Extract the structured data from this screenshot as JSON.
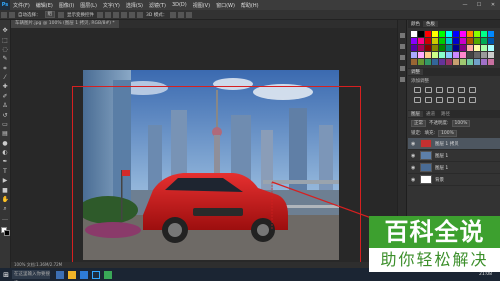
{
  "app": {
    "logo": "Ps"
  },
  "menu": [
    "文件(F)",
    "编辑(E)",
    "图像(I)",
    "图层(L)",
    "文字(Y)",
    "选择(S)",
    "滤镜(T)",
    "3D(D)",
    "视图(V)",
    "窗口(W)",
    "帮助(H)"
  ],
  "window_controls": [
    "—",
    "☐",
    "✕"
  ],
  "options": {
    "auto_select_label": "自动选择：",
    "auto_select_value": "组",
    "transform_label": "显示变换控件",
    "mode_label": "3D 模式："
  },
  "document_tab": "车辆图片.jpg @ 100% (图层 1 拷贝, RGB/8#) *",
  "status": {
    "zoom": "100%",
    "doc": "文档:1.36M/2.72M"
  },
  "panels": {
    "tabs": [
      "颜色",
      "色板"
    ],
    "adjust_title": "调整",
    "adjust_subtitle": "添加调整",
    "layers_tabs": [
      "图层",
      "通道",
      "路径"
    ],
    "blend_mode": "正常",
    "opacity_label": "不透明度:",
    "opacity_value": "100%",
    "lock_label": "锁定:",
    "fill_label": "填充:",
    "fill_value": "100%",
    "layers": [
      {
        "name": "图层 1 拷贝",
        "selected": true
      },
      {
        "name": "图层 1",
        "selected": false
      },
      {
        "name": "图层 1",
        "selected": false
      },
      {
        "name": "背景",
        "selected": false
      }
    ]
  },
  "swatch_colors": [
    "#ffffff",
    "#000000",
    "#ff0000",
    "#ffff00",
    "#00ff00",
    "#00ffff",
    "#0000ff",
    "#ff00ff",
    "#ff8800",
    "#88ff00",
    "#00ff88",
    "#0088ff",
    "#8800ff",
    "#ff0088",
    "#cc0000",
    "#cccc00",
    "#00cc00",
    "#00cccc",
    "#0000cc",
    "#cc00cc",
    "#aa5500",
    "#55aa00",
    "#00aa55",
    "#0055aa",
    "#5500aa",
    "#aa0055",
    "#880000",
    "#888800",
    "#008800",
    "#008888",
    "#000088",
    "#880088",
    "#ffaaaa",
    "#ffffaa",
    "#aaffaa",
    "#aaffff",
    "#aaaaff",
    "#ffaaff",
    "#ffcc88",
    "#ccff88",
    "#88ffcc",
    "#88ccff",
    "#cc88ff",
    "#ff88cc",
    "#444444",
    "#666666",
    "#999999",
    "#cccccc",
    "#996633",
    "#669933",
    "#339966",
    "#336699",
    "#663399",
    "#993366",
    "#c8a070",
    "#a0c870",
    "#70c8a0",
    "#70a0c8",
    "#a070c8",
    "#c870a0"
  ],
  "taskbar": {
    "start": "⊞",
    "search": "在这里输入你要搜索",
    "clock": "21:08"
  },
  "watermark": {
    "top": "百科全说",
    "bottom": "助你轻松解决"
  },
  "colors": {
    "frame": "#d62020",
    "brand": "#3da02f"
  }
}
